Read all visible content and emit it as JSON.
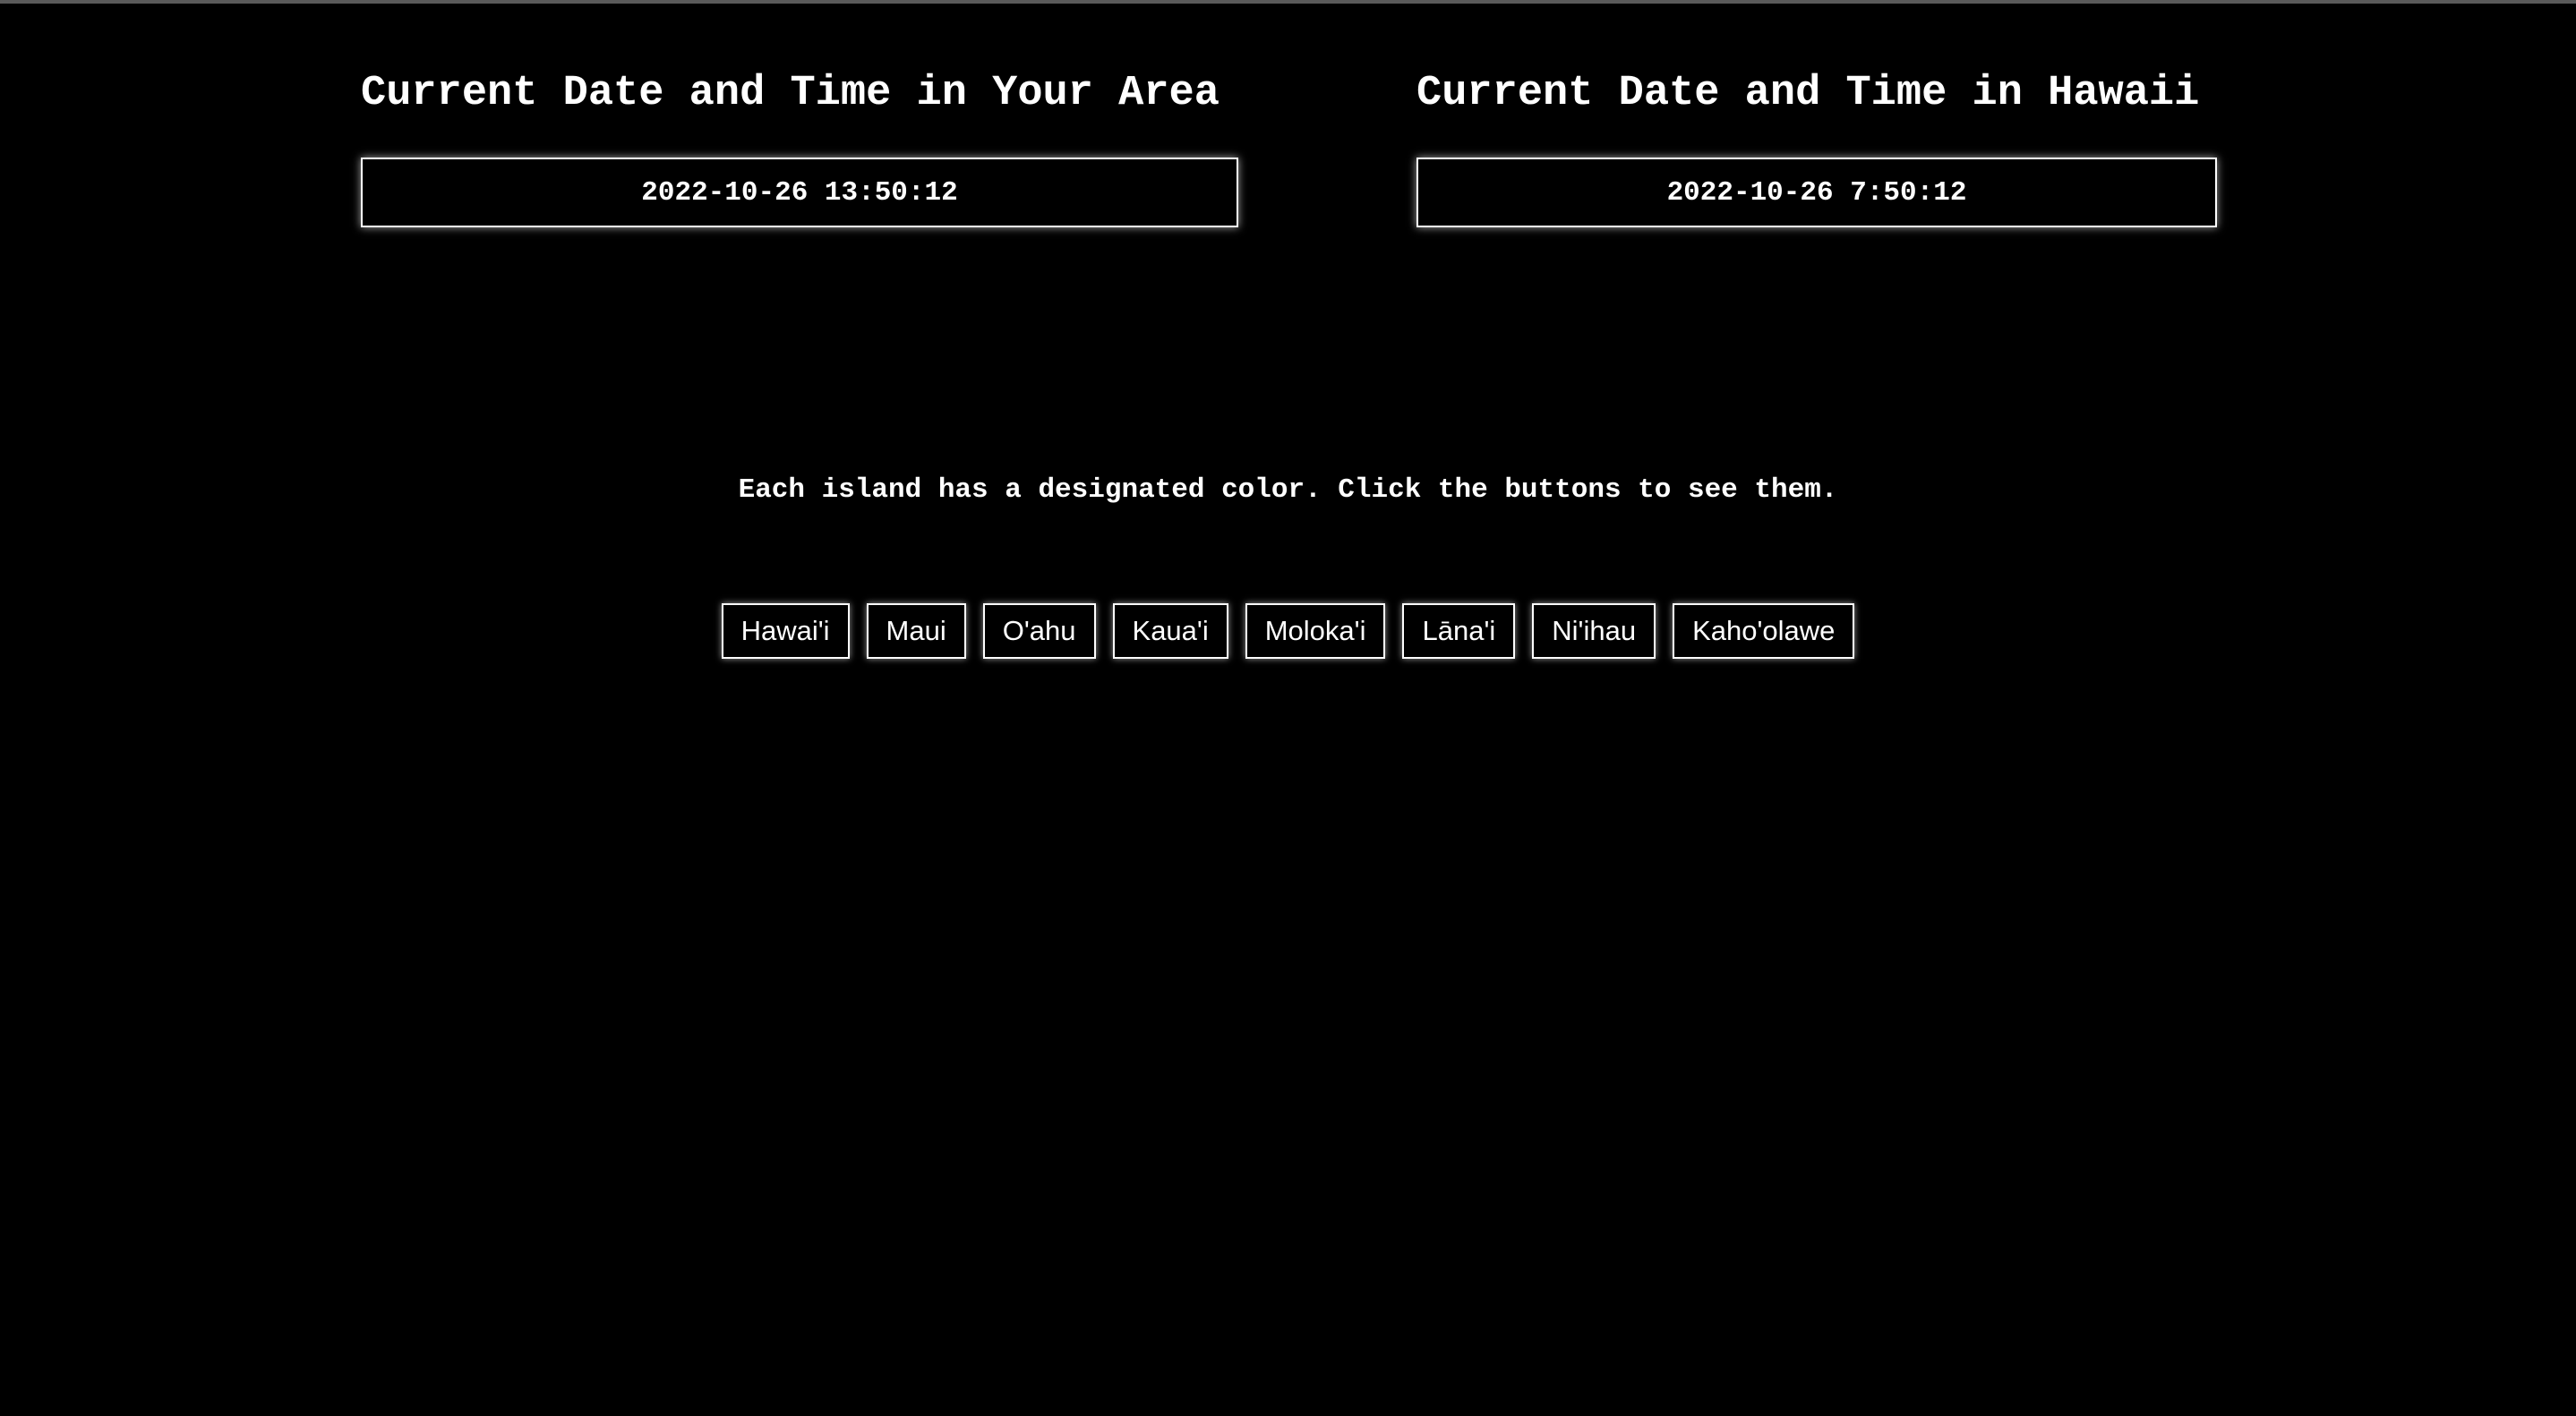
{
  "local": {
    "heading": "Current Date and Time in Your Area",
    "datetime": "2022-10-26 13:50:12"
  },
  "hawaii": {
    "heading": "Current Date and Time in Hawaii",
    "datetime": "2022-10-26 7:50:12"
  },
  "instruction": "Each island has a designated color. Click the buttons to see them.",
  "islands": [
    {
      "label": "Hawai'i"
    },
    {
      "label": "Maui"
    },
    {
      "label": "O'ahu"
    },
    {
      "label": "Kaua'i"
    },
    {
      "label": "Moloka'i"
    },
    {
      "label": "Lāna'i"
    },
    {
      "label": "Ni'ihau"
    },
    {
      "label": "Kaho'olawe"
    }
  ],
  "colors": {
    "background": "#000000",
    "text": "#ffffff",
    "border": "#ffffff"
  }
}
